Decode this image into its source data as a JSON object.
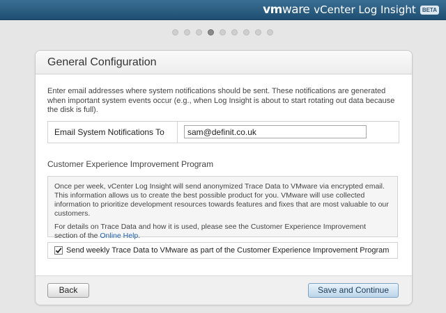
{
  "header": {
    "brand_vm": "vm",
    "brand_ware": "ware",
    "product": "vCenter Log Insight",
    "badge": "BETA"
  },
  "wizard": {
    "total_steps": 9,
    "current_step": 4
  },
  "panel": {
    "title": "General Configuration",
    "intro": "Enter email addresses where system notifications should be sent. These notifications are generated when important system events occur (e.g., when Log Insight is about to start rotating out data because the disk is full).",
    "email_label": "Email System Notifications To",
    "email_value": "sam@definit.co.uk",
    "ceip_title": "Customer Experience Improvement Program",
    "ceip_text": "Once per week, vCenter Log Insight will send anonymized Trace Data to VMware via encrypted email. This information allows us to create the best possible product for you. VMware will use collected information to prioritize development resources towards features and fixes that are most valuable to our customers.",
    "ceip_details_prefix": "For details on Trace Data and how it is used, please see the Customer Experience Improvement section of the ",
    "ceip_link": "Online Help",
    "ceip_details_suffix": ".",
    "checkbox_label": "Send weekly Trace Data to VMware as part of the Customer Experience Improvement Program",
    "checkbox_checked": true
  },
  "footer": {
    "back_label": "Back",
    "continue_label": "Save and Continue"
  },
  "colors": {
    "header_bg": "#2b5b80",
    "primary_button": "#bcd5ea",
    "link": "#1f5fa8"
  }
}
